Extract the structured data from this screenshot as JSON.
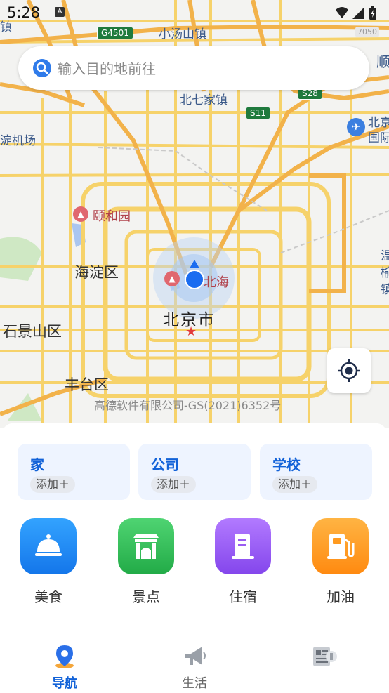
{
  "status_bar": {
    "time": "5:28",
    "notification_glyph": "A"
  },
  "search": {
    "placeholder": "输入目的地前往"
  },
  "map": {
    "labels": {
      "xiaotangshan": "小汤山镇",
      "beiqijia": "北七家镇",
      "airport_partial": "淀机场",
      "beijing_capital_partial_1": "北京",
      "beijing_capital_partial_2": "国际",
      "yiheyuan": "颐和园",
      "haidian": "海淀区",
      "beihai_partial": "北海",
      "beijing_city": "北京市",
      "shijingshan": "石景山区",
      "fengtai": "丰台区",
      "top_left_partial": "镇",
      "top_right_partial": "顺",
      "right_partial_1": "温",
      "right_partial_2": "榆",
      "right_partial_3": "镇"
    },
    "road_shields": {
      "g4501": "G4501",
      "s11": "S11",
      "s28": "S28",
      "top_right": "7050"
    },
    "copyright": "高德软件有限公司-GS(2021)6352号"
  },
  "quick_places": [
    {
      "title": "家",
      "action": "添加＋"
    },
    {
      "title": "公司",
      "action": "添加＋"
    },
    {
      "title": "学校",
      "action": "添加＋"
    }
  ],
  "categories": [
    {
      "label": "美食",
      "icon": "food-cloche-icon"
    },
    {
      "label": "景点",
      "icon": "scenic-gate-icon"
    },
    {
      "label": "住宿",
      "icon": "hotel-icon"
    },
    {
      "label": "加油",
      "icon": "gas-station-icon"
    }
  ],
  "bottom_nav": [
    {
      "label": "导航",
      "icon": "navigation-pin-icon",
      "active": true
    },
    {
      "label": "生活",
      "icon": "megaphone-icon",
      "active": false
    },
    {
      "label": "",
      "icon": "news-icon",
      "active": false
    }
  ],
  "colors": {
    "accent_blue": "#1262d8",
    "map_bg": "#f3f3f1",
    "road_yellow": "#f6d26a",
    "road_orange": "#f2b24a",
    "food": "#1e8cf5",
    "scenic": "#33c25a",
    "hotel": "#9b5cf2",
    "gas": "#ff9a1f"
  }
}
